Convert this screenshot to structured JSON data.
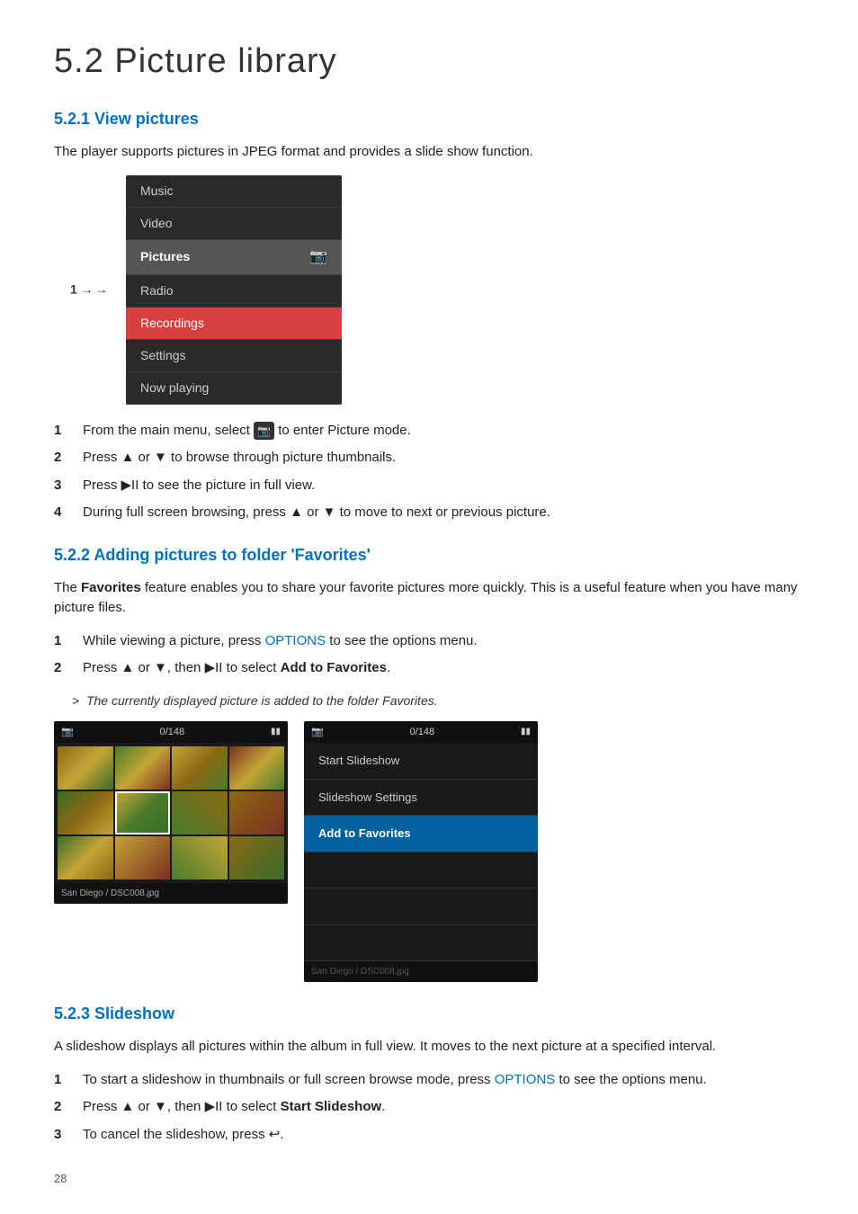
{
  "page": {
    "title": "5.2  Picture library",
    "page_number": "28"
  },
  "section521": {
    "heading": "5.2.1  View pictures",
    "intro": "The player supports pictures in JPEG format and provides a slide show function.",
    "menu_items": [
      {
        "label": "Music",
        "selected": false,
        "highlighted": false
      },
      {
        "label": "Video",
        "selected": false,
        "highlighted": false
      },
      {
        "label": "Pictures",
        "selected": true,
        "highlighted": false
      },
      {
        "label": "Radio",
        "selected": false,
        "highlighted": false
      },
      {
        "label": "Recordings",
        "selected": false,
        "highlighted": true
      },
      {
        "label": "Settings",
        "selected": false,
        "highlighted": false
      },
      {
        "label": "Now playing",
        "selected": false,
        "highlighted": false
      }
    ],
    "menu_label": "1",
    "steps": [
      {
        "num": "1",
        "text": "From the main menu, select",
        "icon": "camera",
        "text2": "to enter Picture mode."
      },
      {
        "num": "2",
        "text": "Press ▲ or ▼ to browse through picture thumbnails."
      },
      {
        "num": "3",
        "text": "Press ▶II to see the picture in full view."
      },
      {
        "num": "4",
        "text": "During full screen browsing, press ▲ or ▼ to move to next or previous picture."
      }
    ]
  },
  "section522": {
    "heading": "5.2.2  Adding pictures to folder 'Favorites'",
    "intro_bold": "Favorites",
    "intro": "feature enables you to share your favorite pictures more quickly. This is a useful feature when you have many picture files.",
    "steps": [
      {
        "num": "1",
        "text": "While viewing a picture, press",
        "options": "OPTIONS",
        "text2": "to see the options menu."
      },
      {
        "num": "2",
        "text": "Press ▲ or ▼, then ▶II to select",
        "bold": "Add to Favorites",
        "text2": "."
      }
    ],
    "blockquote": "The currently displayed picture is added to the folder Favorites.",
    "screenshot_left": {
      "counter": "0/148",
      "footer": "San Diego / DSC008.jpg"
    },
    "screenshot_right": {
      "counter": "0/148",
      "footer": "San Diego / DSC008.jpg",
      "menu_items": [
        {
          "label": "Start Slideshow",
          "active": false
        },
        {
          "label": "Slideshow Settings",
          "active": false
        },
        {
          "label": "Add to Favorites",
          "active": true
        }
      ]
    }
  },
  "section523": {
    "heading": "5.2.3  Slideshow",
    "intro": "A slideshow displays all pictures within the album in full view. It moves to the next picture at a specified interval.",
    "steps": [
      {
        "num": "1",
        "text": "To start a slideshow in thumbnails or full screen browse mode, press",
        "options": "OPTIONS",
        "text2": "to see the options menu."
      },
      {
        "num": "2",
        "text": "Press ▲ or ▼, then ▶II to select",
        "bold": "Start Slideshow",
        "text2": "."
      },
      {
        "num": "3",
        "text": "To cancel the slideshow, press ↩."
      }
    ]
  }
}
